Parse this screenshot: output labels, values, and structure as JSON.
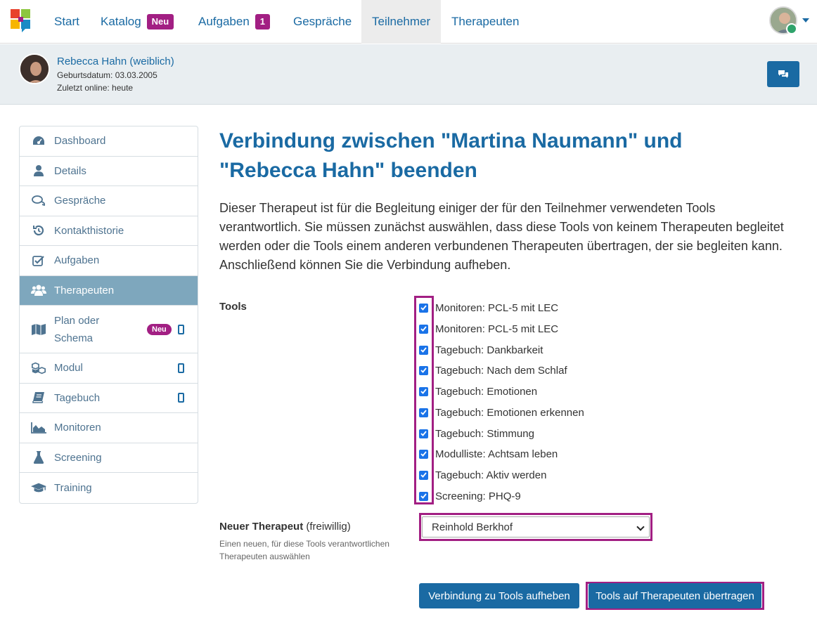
{
  "nav": {
    "items": [
      {
        "label": "Start"
      },
      {
        "label": "Katalog",
        "badge": "Neu"
      },
      {
        "label": "Aufgaben",
        "badge": "1"
      },
      {
        "label": "Gespräche"
      },
      {
        "label": "Teilnehmer",
        "active": true
      },
      {
        "label": "Therapeuten"
      }
    ],
    "user_icon": "user-avatar-icon"
  },
  "profile": {
    "name": "Rebecca Hahn (weiblich)",
    "birthdate": "Geburtsdatum: 03.03.2005",
    "last_online": "Zuletzt online: heute",
    "chat_icon": "chat-bubbles-icon"
  },
  "sidebar": {
    "items": [
      {
        "label": "Dashboard",
        "icon": "dashboard-icon"
      },
      {
        "label": "Details",
        "icon": "user-icon"
      },
      {
        "label": "Gespräche",
        "icon": "comments-icon"
      },
      {
        "label": "Kontakthistorie",
        "icon": "history-icon"
      },
      {
        "label": "Aufgaben",
        "icon": "checkbox-icon"
      },
      {
        "label": "Therapeuten",
        "icon": "users-icon",
        "active": true
      },
      {
        "label": "Plan oder Schema",
        "icon": "map-icon",
        "badge": "Neu",
        "mobile": true
      },
      {
        "label": "Modul",
        "icon": "cubes-icon",
        "mobile": true
      },
      {
        "label": "Tagebuch",
        "icon": "book-icon",
        "mobile": true
      },
      {
        "label": "Monitoren",
        "icon": "area-chart-icon"
      },
      {
        "label": "Screening",
        "icon": "flask-icon"
      },
      {
        "label": "Training",
        "icon": "graduation-cap-icon"
      }
    ]
  },
  "main": {
    "title": "Verbindung zwischen \"Martina Naumann\" und \"Rebecca Hahn\" beenden",
    "description": "Dieser Therapeut ist für die Begleitung einiger der für den Teilnehmer verwendeten Tools verantwortlich. Sie müssen zunächst auswählen, dass diese Tools von keinem Therapeuten begleitet werden oder die Tools einem anderen verbundenen Therapeuten übertragen, der sie begleiten kann. Anschließend können Sie die Verbindung aufheben.",
    "tools_label": "Tools",
    "tools": [
      {
        "label": "Monitoren: PCL-5 mit LEC",
        "checked": true
      },
      {
        "label": "Monitoren: PCL-5 mit LEC",
        "checked": true
      },
      {
        "label": "Tagebuch: Dankbarkeit",
        "checked": true
      },
      {
        "label": "Tagebuch: Nach dem Schlaf",
        "checked": true
      },
      {
        "label": "Tagebuch: Emotionen",
        "checked": true
      },
      {
        "label": "Tagebuch: Emotionen erkennen",
        "checked": true
      },
      {
        "label": "Tagebuch: Stimmung",
        "checked": true
      },
      {
        "label": "Modulliste: Achtsam leben",
        "checked": true
      },
      {
        "label": "Tagebuch: Aktiv werden",
        "checked": true
      },
      {
        "label": "Screening: PHQ-9",
        "checked": true
      }
    ],
    "new_therapist": {
      "label": "Neuer Therapeut",
      "optional": "(freiwillig)",
      "hint": "Einen neuen, für diese Tools verantwortlichen Therapeuten auswählen",
      "selected": "Reinhold Berkhof"
    },
    "buttons": {
      "unlink": "Verbindung zu Tools aufheben",
      "transfer": "Tools auf Therapeuten übertragen"
    },
    "highlight_color": "#a21f83",
    "accent_color": "#1a6aa3"
  }
}
